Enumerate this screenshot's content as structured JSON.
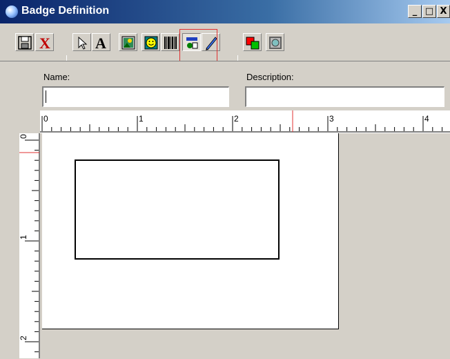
{
  "window": {
    "title": "Badge Definition",
    "controls": [
      "_",
      "□",
      "X"
    ]
  },
  "toolbar": {
    "buttons": [
      {
        "name": "save",
        "icon": "floppy-disk-icon"
      },
      {
        "name": "close",
        "icon": "red-x-icon"
      },
      {
        "name": "select",
        "icon": "pointer-arrow-icon"
      },
      {
        "name": "text",
        "icon": "letter-a-icon",
        "glyph": "A"
      },
      {
        "name": "image",
        "icon": "picture-icon"
      },
      {
        "name": "photo",
        "icon": "smiley-face-icon"
      },
      {
        "name": "barcode",
        "icon": "barcode-icon"
      },
      {
        "name": "shapes",
        "icon": "shapes-icon",
        "pressed": true
      },
      {
        "name": "line",
        "icon": "pen-icon"
      },
      {
        "name": "layers",
        "icon": "layers-icon"
      },
      {
        "name": "background",
        "icon": "background-pattern-icon"
      }
    ]
  },
  "form": {
    "name_label": "Name:",
    "name_value": "",
    "description_label": "Description:",
    "description_value": ""
  },
  "ruler": {
    "horizontal_numbers": [
      "0",
      "1",
      "2",
      "3",
      "4"
    ],
    "vertical_numbers": [
      "0",
      "1",
      "2"
    ]
  },
  "colors": {
    "accent_red": "#e03030",
    "title_blue": "#0a246a"
  }
}
